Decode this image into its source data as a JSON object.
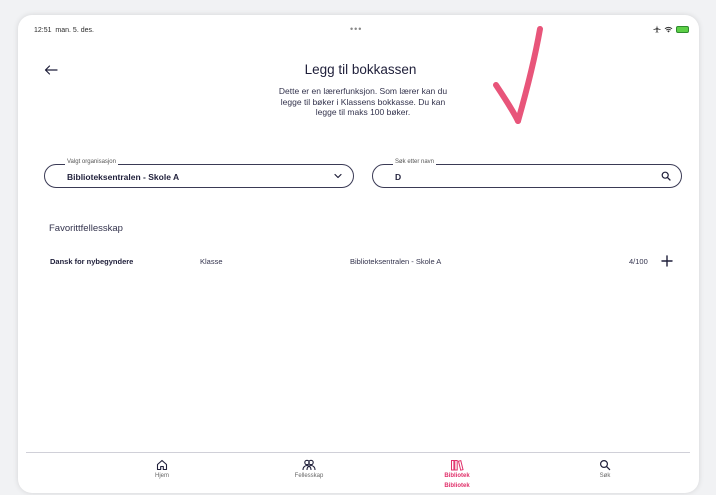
{
  "status_bar": {
    "time": "12:51",
    "date": "man. 5. des.",
    "dots": "•••"
  },
  "header": {
    "title": "Legg til bokkassen",
    "description": "Dette er en lærerfunksjon. Som lærer kan du legge til bøker i Klassens bokkasse. Du kan legge til maks 100 bøker."
  },
  "organization_select": {
    "legend": "Valgt organisasjon",
    "value": "Biblioteksentralen - Skole A"
  },
  "search": {
    "legend": "Søk etter navn",
    "value": "D"
  },
  "favorites": {
    "section_title": "Favorittfellesskap",
    "rows": [
      {
        "name": "Dansk for nybegyndere",
        "type": "Klasse",
        "organization": "Biblioteksentralen - Skole A",
        "count": "4/100"
      }
    ]
  },
  "tab_bar": {
    "tabs": [
      {
        "label": "Hjem",
        "icon": "home-icon"
      },
      {
        "label": "Fellesskap",
        "icon": "community-icon"
      },
      {
        "label": "Bibliotek",
        "icon": "library-icon",
        "active": true
      },
      {
        "label": "Søk",
        "icon": "search-icon"
      }
    ],
    "active_sublabel": "Bibliotek"
  },
  "colors": {
    "accent": "#e0306a",
    "text": "#1f1f3a",
    "annotation": "#e8557a"
  }
}
